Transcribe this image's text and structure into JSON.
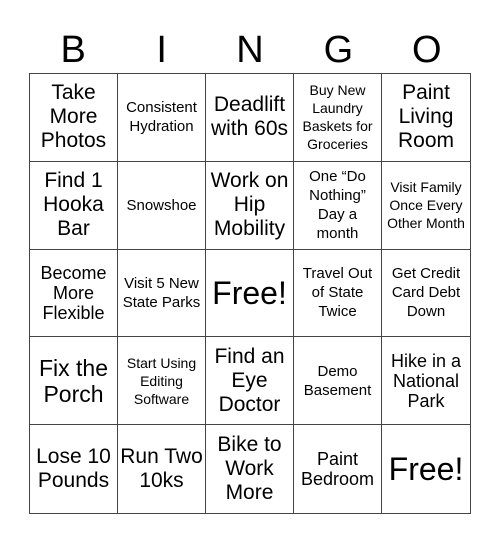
{
  "header": {
    "letters": [
      "B",
      "I",
      "N",
      "G",
      "O"
    ]
  },
  "cells": [
    {
      "text": "Take More Photos",
      "size": "s-l2"
    },
    {
      "text": "Consistent Hydration",
      "size": "s-s"
    },
    {
      "text": "Deadlift with 60s",
      "size": "s-l2"
    },
    {
      "text": "Buy New Laundry Baskets for Groceries",
      "size": "s-xs"
    },
    {
      "text": "Paint Living Room",
      "size": "s-l2"
    },
    {
      "text": "Find 1 Hooka Bar",
      "size": "s-l2"
    },
    {
      "text": "Snowshoe",
      "size": "s-s"
    },
    {
      "text": "Work on Hip Mobility",
      "size": "s-l2"
    },
    {
      "text": "One “Do Nothing” Day a month",
      "size": "s-s"
    },
    {
      "text": "Visit Family Once Every Other Month",
      "size": "s-xs"
    },
    {
      "text": "Become More Flexible",
      "size": "s-m"
    },
    {
      "text": "Visit 5 New State Parks",
      "size": "s-s"
    },
    {
      "text": "Free!",
      "size": "s-xl"
    },
    {
      "text": "Travel Out of State Twice",
      "size": "s-s"
    },
    {
      "text": "Get Credit Card Debt Down",
      "size": "s-s"
    },
    {
      "text": "Fix the Porch",
      "size": "s-l"
    },
    {
      "text": "Start Using Editing Software",
      "size": "s-xs"
    },
    {
      "text": "Find an Eye Doctor",
      "size": "s-l2"
    },
    {
      "text": "Demo Basement",
      "size": "s-s"
    },
    {
      "text": "Hike in a National Park",
      "size": "s-m"
    },
    {
      "text": "Lose 10 Pounds",
      "size": "s-l2"
    },
    {
      "text": "Run Two 10ks",
      "size": "s-l2"
    },
    {
      "text": "Bike to Work More",
      "size": "s-l2"
    },
    {
      "text": "Paint Bedroom",
      "size": "s-m"
    },
    {
      "text": "Free!",
      "size": "s-xl"
    }
  ]
}
